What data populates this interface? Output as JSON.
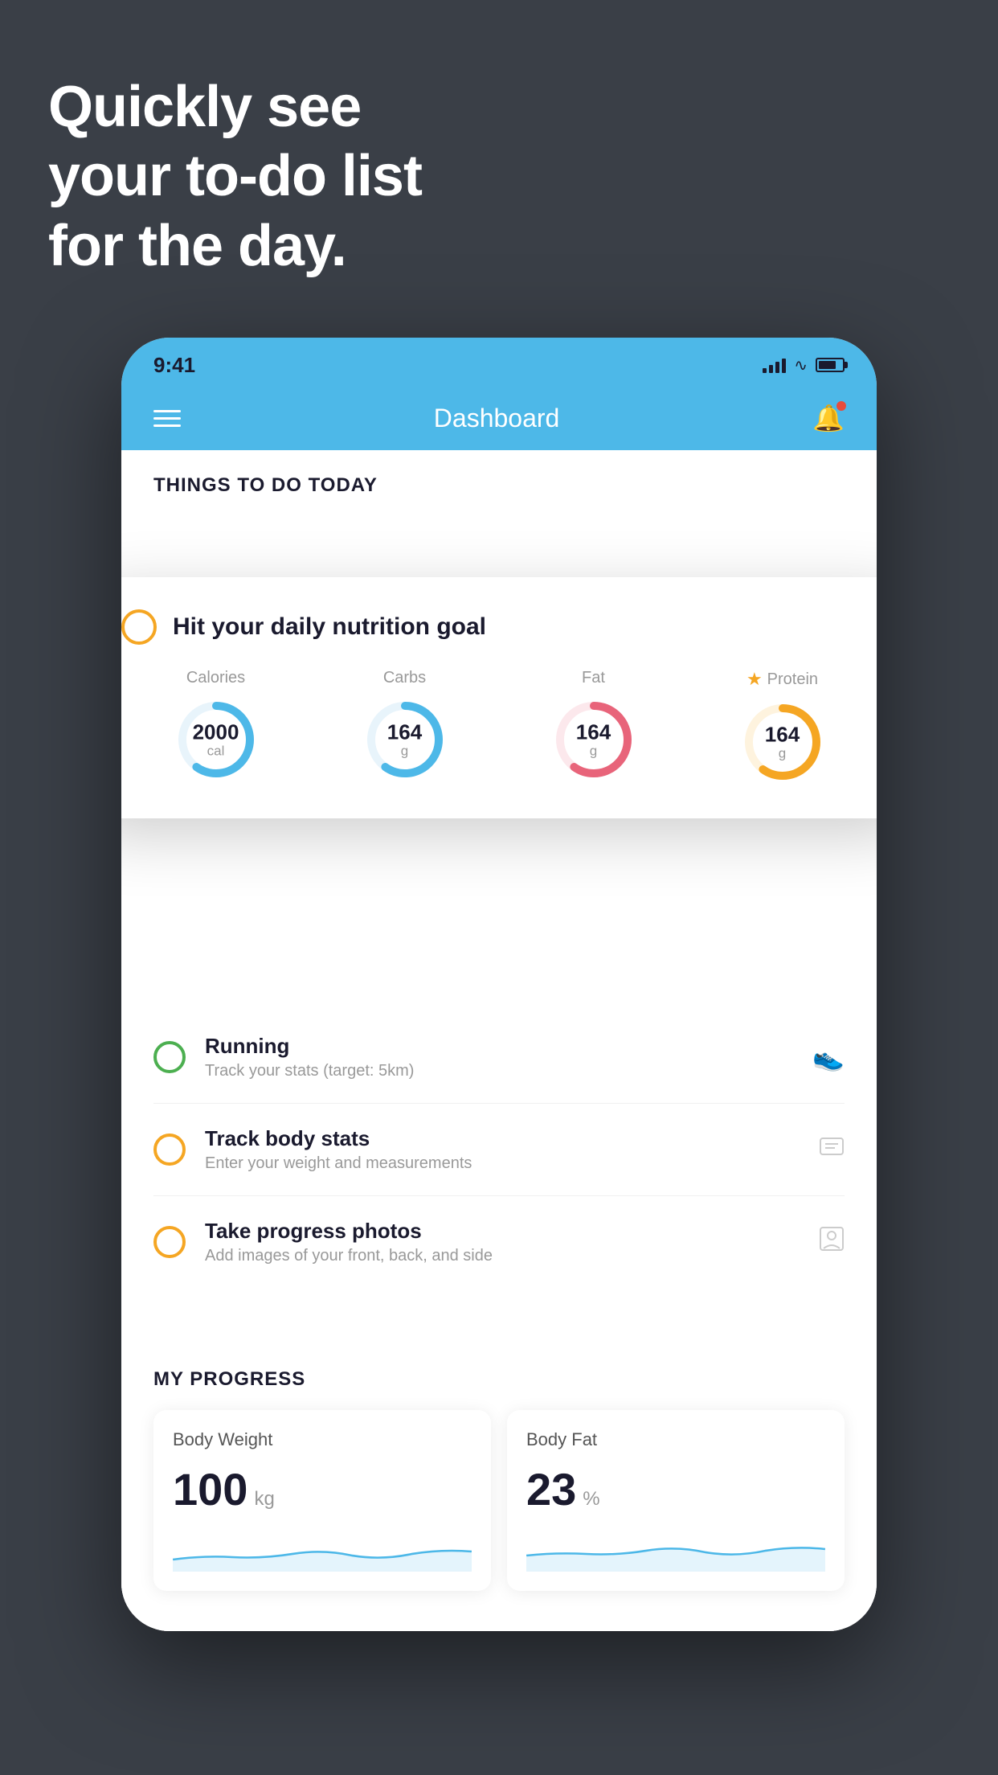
{
  "hero": {
    "line1": "Quickly see",
    "line2": "your to-do list",
    "line3": "for the day."
  },
  "statusBar": {
    "time": "9:41"
  },
  "navBar": {
    "title": "Dashboard"
  },
  "thingsToDo": {
    "sectionTitle": "THINGS TO DO TODAY",
    "floatingCard": {
      "checkboxColor": "#f5a623",
      "title": "Hit your daily nutrition goal",
      "nutrition": [
        {
          "label": "Calories",
          "value": "2000",
          "unit": "cal",
          "color": "#4db8e8",
          "percent": 60,
          "hasStar": false
        },
        {
          "label": "Carbs",
          "value": "164",
          "unit": "g",
          "color": "#4db8e8",
          "percent": 60,
          "hasStar": false
        },
        {
          "label": "Fat",
          "value": "164",
          "unit": "g",
          "color": "#e8647a",
          "percent": 60,
          "hasStar": false
        },
        {
          "label": "Protein",
          "value": "164",
          "unit": "g",
          "color": "#f5a623",
          "percent": 60,
          "hasStar": true
        }
      ]
    },
    "items": [
      {
        "id": "running",
        "title": "Running",
        "subtitle": "Track your stats (target: 5km)",
        "circleColor": "green",
        "icon": "shoe"
      },
      {
        "id": "track-body-stats",
        "title": "Track body stats",
        "subtitle": "Enter your weight and measurements",
        "circleColor": "yellow",
        "icon": "scale"
      },
      {
        "id": "progress-photos",
        "title": "Take progress photos",
        "subtitle": "Add images of your front, back, and side",
        "circleColor": "yellow",
        "icon": "person"
      }
    ]
  },
  "myProgress": {
    "sectionTitle": "MY PROGRESS",
    "cards": [
      {
        "title": "Body Weight",
        "value": "100",
        "unit": "kg"
      },
      {
        "title": "Body Fat",
        "value": "23",
        "unit": "%"
      }
    ]
  }
}
